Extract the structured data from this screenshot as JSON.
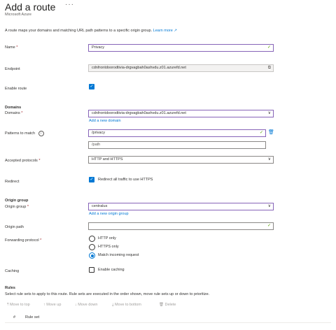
{
  "header": {
    "title": "Add a route",
    "more_label": "···",
    "subtitle": "Microsoft Azure"
  },
  "description": {
    "text": "A route maps your domains and matching URL path patterns to a specific origin group.",
    "learn_more": "Learn more",
    "external_icon": "external-link-icon"
  },
  "form": {
    "name": {
      "label": "Name",
      "required": "*",
      "value": "Privacy",
      "icon": "check-icon"
    },
    "endpoint": {
      "label": "Endpoint",
      "value": "cdnfrontdoorodtivia-drgvagbah0ashvdu.z01.azurefd.net",
      "icon": "copy-icon"
    },
    "enable_route": {
      "label": "Enable route",
      "checked": true
    },
    "domains_section": "Domains",
    "domains": {
      "label": "Domains",
      "required": "*",
      "value": "cdnfrontdoorodtivia-drgvagbah0ashvdu.z01.azurefd.net",
      "add_link": "Add a new domain"
    },
    "patterns": {
      "label": "Patterns to match",
      "info_icon": "info-icon",
      "value": "/privacy",
      "placeholder": "/path"
    },
    "protocols": {
      "label": "Accepted protocols",
      "required": "*",
      "value": "HTTP and HTTPS"
    },
    "redirect": {
      "label": "Redirect",
      "checkbox_label": "Redirect all traffic to use HTTPS",
      "checked": true
    },
    "origin_section": "Origin group",
    "origin_group": {
      "label": "Origin group",
      "required": "*",
      "value": "centralus",
      "add_link": "Add a new origin group"
    },
    "origin_path": {
      "label": "Origin path",
      "value": ""
    },
    "forwarding": {
      "label": "Forwarding protocol",
      "required": "*",
      "options": [
        "HTTP only",
        "HTTPS only",
        "Match incoming request"
      ],
      "selected": "Match incoming request"
    },
    "caching": {
      "label": "Caching",
      "checkbox_label": "Enable caching",
      "checked": false
    }
  },
  "rules": {
    "title": "Rules",
    "description": "Select rule sets to apply to this route. Rule sets are executed in the order shown, move rule sets up or down to prioritize.",
    "toolbar": {
      "move_top": "Move to top",
      "move_up": "Move up",
      "move_down": "Move down",
      "move_bottom": "Move to bottom",
      "delete": "Delete"
    },
    "columns": [
      "#",
      "Rule set"
    ]
  },
  "colors": {
    "accent": "#0078d4",
    "focus_border": "#8764b8",
    "required": "#a4262c",
    "valid": "#57a300"
  }
}
